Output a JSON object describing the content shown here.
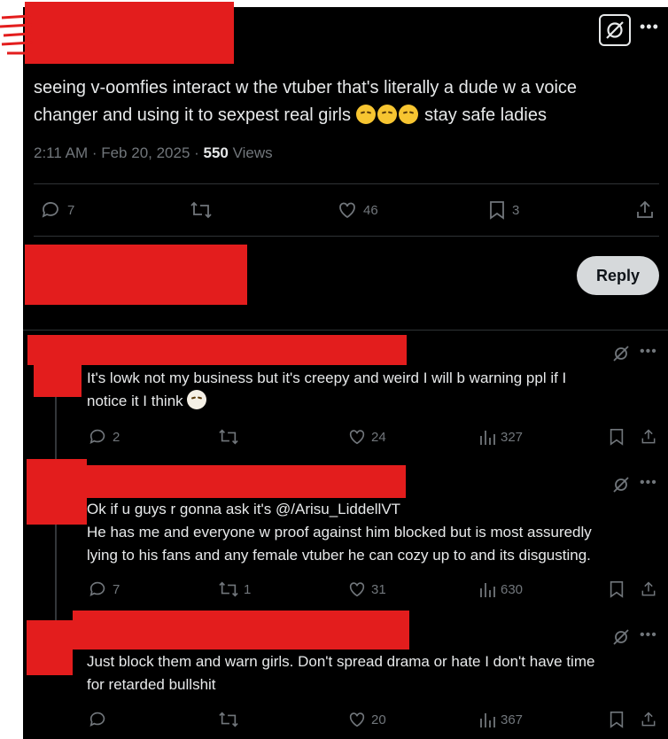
{
  "post": {
    "text_line1": "seeing v-oomfies interact w the vtuber that's literally a dude w a voice",
    "text_line2": "changer and using it to sexpest real girls",
    "text_end": "stay safe ladies",
    "timestamp": "2:11 AM · Feb 20, 2025 · ",
    "views_count": "550",
    "views_label": " Views",
    "replies": "7",
    "reposts": "",
    "likes": "46",
    "bookmarks": "3"
  },
  "reply_button": "Reply",
  "replies": [
    {
      "line1": "It's lowk not my business but it's creepy and weird  I will b warning ppl if I",
      "line2": "notice it I think",
      "replies": "2",
      "reposts": "",
      "likes": "24",
      "views": "327"
    },
    {
      "line1": "Ok if u guys r gonna ask it's @/Arisu_LiddellVT",
      "line2": "He has me and everyone w proof against him blocked but is most assuredly",
      "line3": "lying to his fans and any female vtuber he can cozy up to and its disgusting.",
      "replies": "7",
      "reposts": "1",
      "likes": "31",
      "views": "630"
    },
    {
      "line1": "Just block them and warn girls. Don't spread drama or hate I don't have time",
      "line2": "for retarded bullshit",
      "replies": "",
      "reposts": "",
      "likes": "20",
      "views": "367"
    }
  ],
  "colors": {
    "background": "#000000",
    "redaction": "#e31d1d",
    "muted": "#71767b",
    "text": "#e7e9ea"
  },
  "icons": [
    "grok-icon",
    "reply-icon",
    "repost-icon",
    "like-icon",
    "bookmark-icon",
    "share-icon",
    "views-icon",
    "more-icon"
  ]
}
